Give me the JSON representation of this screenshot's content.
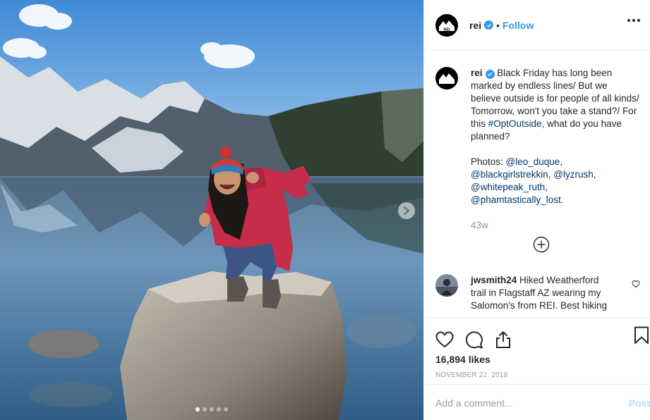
{
  "colors": {
    "accent": "#3897f0",
    "link": "#003569",
    "muted": "#999999",
    "post_disabled": "#b2dffc"
  },
  "photo": {
    "alt_icon": "landscape-photo",
    "carousel_dots": 5,
    "active_dot": 0
  },
  "header": {
    "username": "rei",
    "separator": "•",
    "follow_label": "Follow",
    "avatar_text": "REI"
  },
  "caption": {
    "username": "rei",
    "text_1": "Black Friday has long been marked by endless lines/ But we believe outside is for people of all kinds/ Tomorrow, won't you take a stand?/ For this ",
    "hashtag": "#OptOutside",
    "text_2": ", what do you have planned?",
    "photos_label": "Photos: ",
    "mention_1": "@leo_duque",
    "mention_2": "@blackgirlstrekkin",
    "mention_3": "@lyzrush",
    "mention_4": "@whitepeak_ruth",
    "mention_5": "@phamtastically_lost",
    "sep_comma": ", ",
    "period": ".",
    "time_ago": "43w"
  },
  "comment": {
    "username": "jwsmith24",
    "text": "Hiked Weatherford trail in Flagstaff AZ wearing my Salomon's from REI. Best hiking"
  },
  "post": {
    "likes": "16,894 likes",
    "date": "November 22, 2018",
    "add_comment_placeholder": "Add a comment...",
    "post_label": "Post"
  }
}
